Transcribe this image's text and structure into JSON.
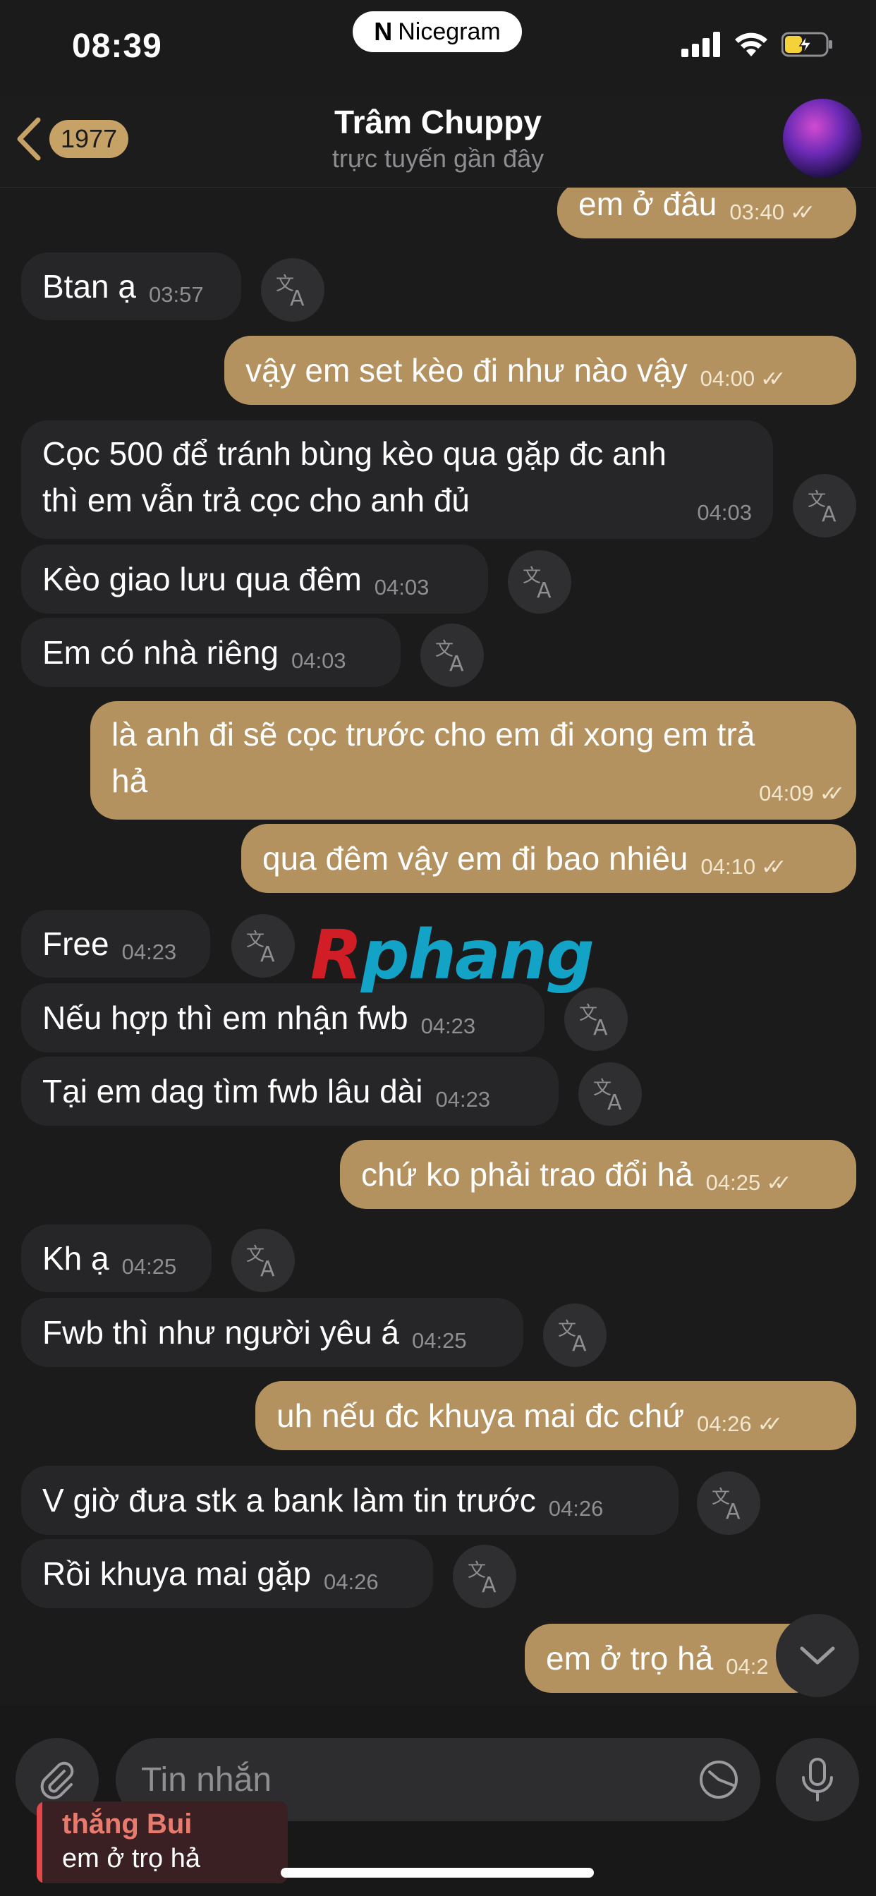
{
  "status_bar": {
    "time": "08:39",
    "app_pill": "Nicegram",
    "app_pill_logo": "N"
  },
  "header": {
    "back_count": "1977",
    "title": "Trâm Chuppy",
    "subtitle": "trực tuyến gần đây"
  },
  "messages": [
    {
      "dir": "out",
      "text": "em ở đâu",
      "time": "03:40",
      "ticks": "✓✓"
    },
    {
      "dir": "in",
      "text": "Btan ạ",
      "time": "03:57"
    },
    {
      "dir": "out",
      "text": "vậy em set kèo đi như nào vậy",
      "time": "04:00",
      "ticks": "✓✓"
    },
    {
      "dir": "in",
      "text": "Cọc 500 để tránh bùng kèo qua gặp đc anh",
      "text2": "thì em vẫn trả cọc cho anh đủ",
      "time": "04:03"
    },
    {
      "dir": "in",
      "text": "Kèo giao lưu qua đêm",
      "time": "04:03"
    },
    {
      "dir": "in",
      "text": "Em có nhà riêng",
      "time": "04:03"
    },
    {
      "dir": "out",
      "text": "là anh đi sẽ cọc trước cho em đi xong em trả",
      "text2": "hả",
      "time": "04:09",
      "ticks": "✓✓"
    },
    {
      "dir": "out",
      "text": "qua đêm vậy em đi bao nhiêu",
      "time": "04:10",
      "ticks": "✓✓"
    },
    {
      "dir": "in",
      "text": "Free",
      "time": "04:23"
    },
    {
      "dir": "in",
      "text": "Nếu hợp thì em nhận fwb",
      "time": "04:23"
    },
    {
      "dir": "in",
      "text": "Tại em dag tìm fwb lâu dài",
      "time": "04:23"
    },
    {
      "dir": "out",
      "text": "chứ ko phải trao đổi hả",
      "time": "04:25",
      "ticks": "✓✓"
    },
    {
      "dir": "in",
      "text": "Kh ạ",
      "time": "04:25"
    },
    {
      "dir": "in",
      "text": "Fwb thì như người yêu á",
      "time": "04:25"
    },
    {
      "dir": "out",
      "text": "uh nếu đc khuya mai đc chứ",
      "time": "04:26",
      "ticks": "✓✓"
    },
    {
      "dir": "in",
      "text": "V giờ đưa stk a bank làm tin trước",
      "time": "04:26"
    },
    {
      "dir": "in",
      "text": "Rồi khuya mai gặp",
      "time": "04:26"
    },
    {
      "dir": "out",
      "text": "em ở trọ hả",
      "time": "04:2"
    }
  ],
  "watermark": {
    "first": "R",
    "rest": "phang"
  },
  "input": {
    "placeholder": "Tin nhắn"
  },
  "reply_preview": {
    "name": "thắng Bui",
    "text": "em ở trọ hả"
  },
  "icons": {
    "translate": "translate-icon",
    "back": "chevron-left-icon",
    "attach": "paperclip-icon",
    "sticker": "sticker-icon",
    "mic": "microphone-icon",
    "scroll": "chevron-down-icon",
    "signal": "signal-icon",
    "wifi": "wifi-icon",
    "battery": "battery-charging-icon"
  },
  "colors": {
    "outgoing_bubble": "#b3925f",
    "incoming_bubble": "#262628",
    "background": "#1b1b1c",
    "accent": "#c6a267"
  }
}
